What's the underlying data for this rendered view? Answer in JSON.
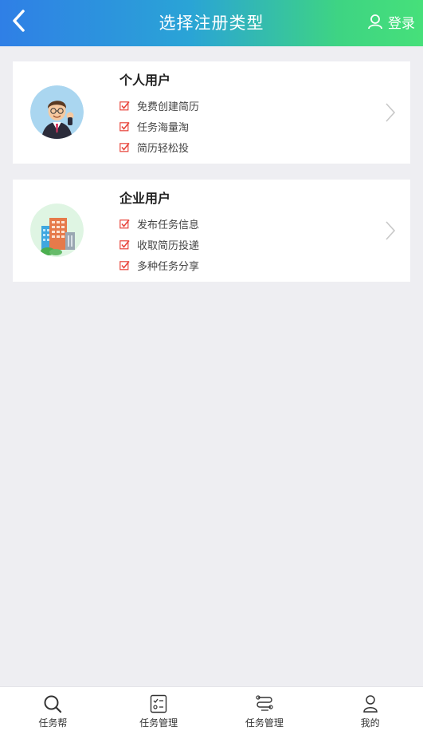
{
  "header": {
    "title": "选择注册类型",
    "login_label": "登录",
    "back_icon": "chevron-left-icon",
    "login_icon": "user-outline-icon"
  },
  "cards": [
    {
      "title": "个人用户",
      "avatar_icon": "businessman-avatar",
      "features": [
        "免费创建简历",
        "任务海量淘",
        "简历轻松投"
      ]
    },
    {
      "title": "企业用户",
      "avatar_icon": "office-building-avatar",
      "features": [
        "发布任务信息",
        "收取简历投递",
        "多种任务分享"
      ]
    }
  ],
  "tabbar": {
    "items": [
      {
        "label": "任务帮",
        "icon": "search-icon"
      },
      {
        "label": "任务管理",
        "icon": "checklist-icon"
      },
      {
        "label": "任务管理",
        "icon": "route-icon"
      },
      {
        "label": "我的",
        "icon": "user-icon"
      }
    ]
  },
  "colors": {
    "header_gradient_start": "#2f7fe6",
    "header_gradient_end": "#46e07a",
    "check_red": "#e8453c",
    "background": "#eeeef2"
  }
}
